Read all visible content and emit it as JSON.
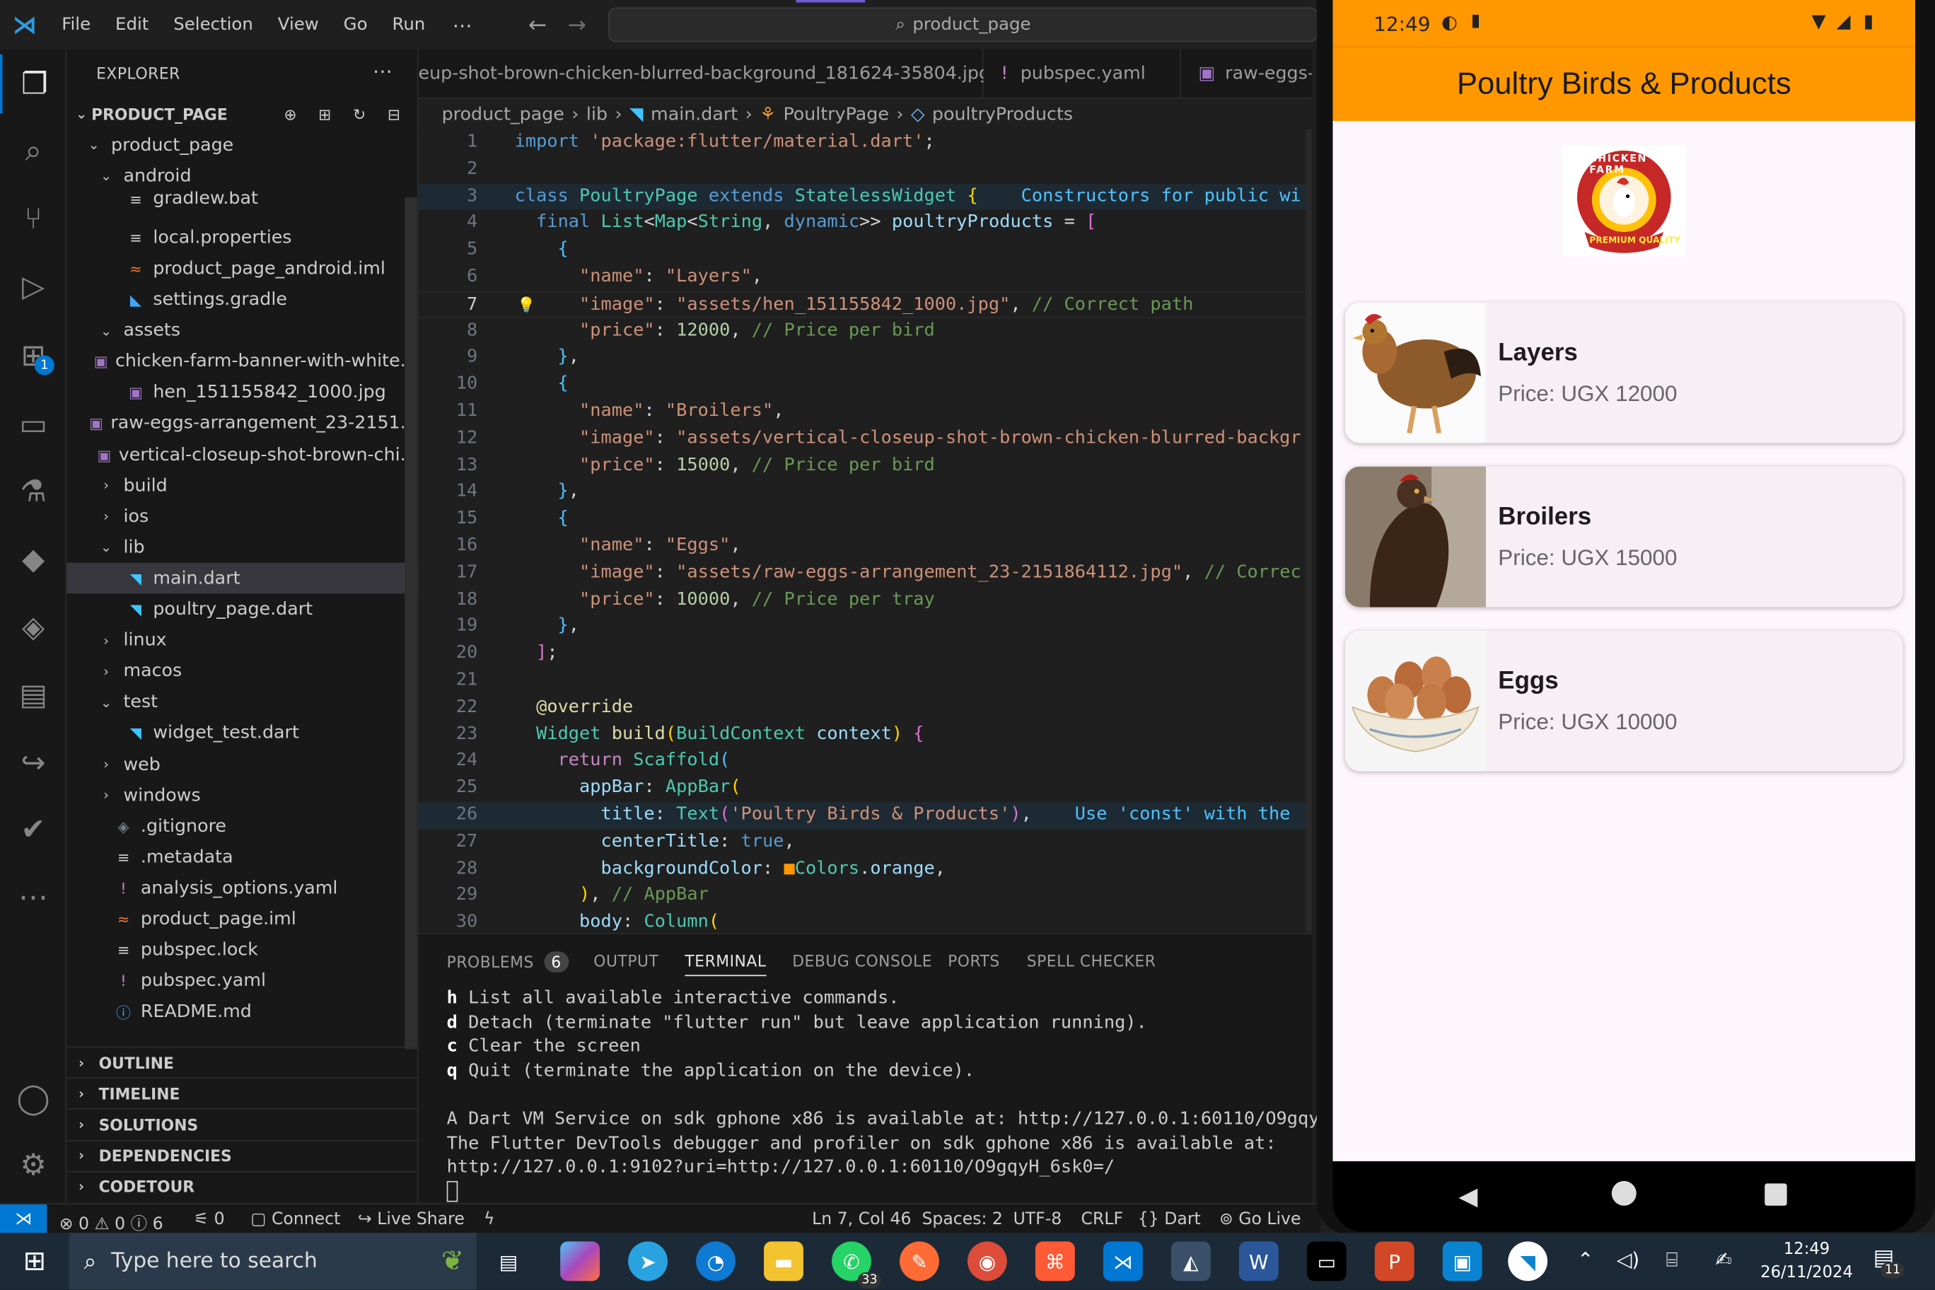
{
  "titlebar": {
    "menus": [
      "File",
      "Edit",
      "Selection",
      "View",
      "Go",
      "Run"
    ],
    "more": "⋯",
    "search_text": "product_page"
  },
  "sidebar": {
    "title": "EXPLORER",
    "project": "PRODUCT_PAGE",
    "rows": [
      {
        "label": "product_page",
        "indent": 1,
        "chev": "v"
      },
      {
        "label": "android",
        "indent": 2,
        "chev": "v"
      },
      {
        "label": "gradlew.bat",
        "indent": 3,
        "icon": "≡"
      },
      {
        "label": "local.properties",
        "indent": 3,
        "icon": "≡"
      },
      {
        "label": "product_page_android.iml",
        "indent": 3,
        "icon": "≈"
      },
      {
        "label": "settings.gradle",
        "indent": 3,
        "icon": "◣"
      },
      {
        "label": "assets",
        "indent": 2,
        "chev": "v"
      },
      {
        "label": "chicken-farm-banner-with-white...",
        "indent": 3,
        "icon": "▣"
      },
      {
        "label": "hen_151155842_1000.jpg",
        "indent": 3,
        "icon": "▣"
      },
      {
        "label": "raw-eggs-arrangement_23-2151...",
        "indent": 3,
        "icon": "▣"
      },
      {
        "label": "vertical-closeup-shot-brown-chi...",
        "indent": 3,
        "icon": "▣"
      },
      {
        "label": "build",
        "indent": 2,
        "chev": ">"
      },
      {
        "label": "ios",
        "indent": 2,
        "chev": ">"
      },
      {
        "label": "lib",
        "indent": 2,
        "chev": "v"
      },
      {
        "label": "main.dart",
        "indent": 3,
        "icon": "◥",
        "selected": true
      },
      {
        "label": "poultry_page.dart",
        "indent": 3,
        "icon": "◥"
      },
      {
        "label": "linux",
        "indent": 2,
        "chev": ">"
      },
      {
        "label": "macos",
        "indent": 2,
        "chev": ">"
      },
      {
        "label": "test",
        "indent": 2,
        "chev": "v"
      },
      {
        "label": "widget_test.dart",
        "indent": 3,
        "icon": "◥"
      },
      {
        "label": "web",
        "indent": 2,
        "chev": ">"
      },
      {
        "label": "windows",
        "indent": 2,
        "chev": ">"
      },
      {
        "label": ".gitignore",
        "indent": 2,
        "icon": "◈"
      },
      {
        "label": ".metadata",
        "indent": 2,
        "icon": "≡"
      },
      {
        "label": "analysis_options.yaml",
        "indent": 2,
        "icon": "!"
      },
      {
        "label": "product_page.iml",
        "indent": 2,
        "icon": "≈"
      },
      {
        "label": "pubspec.lock",
        "indent": 2,
        "icon": "≡"
      },
      {
        "label": "pubspec.yaml",
        "indent": 2,
        "icon": "!"
      },
      {
        "label": "README.md",
        "indent": 2,
        "icon": "ⓘ"
      }
    ],
    "sections": [
      "OUTLINE",
      "TIMELINE",
      "SOLUTIONS",
      "DEPENDENCIES",
      "CODETOUR"
    ]
  },
  "tabs": [
    {
      "label": "eup-shot-brown-chicken-blurred-background_181624-35804.jpg"
    },
    {
      "label": "pubspec.yaml"
    },
    {
      "label": "raw-eggs-"
    }
  ],
  "breadcrumb": [
    "product_page",
    "lib",
    "main.dart",
    "PoultryPage",
    "poultryProducts"
  ],
  "code": [
    {
      "n": "1",
      "segs": [
        [
          "kw",
          "import "
        ],
        [
          "str",
          "'package:flutter/material.dart'"
        ],
        [
          "plain",
          ";"
        ]
      ]
    },
    {
      "n": "2",
      "segs": []
    },
    {
      "n": "3",
      "segs": [
        [
          "kw",
          "class "
        ],
        [
          "cls",
          "PoultryPage "
        ],
        [
          "kw",
          "extends "
        ],
        [
          "cls",
          "StatelessWidget "
        ],
        [
          "gold",
          "{"
        ],
        [
          "hint",
          "    Constructors for public wi"
        ]
      ]
    },
    {
      "n": "4",
      "segs": [
        [
          "plain",
          "  "
        ],
        [
          "kw",
          "final "
        ],
        [
          "cls",
          "List"
        ],
        [
          "plain",
          "<"
        ],
        [
          "cls",
          "Map"
        ],
        [
          "plain",
          "<"
        ],
        [
          "cls",
          "String"
        ],
        [
          "plain",
          ", "
        ],
        [
          "kw",
          "dynamic"
        ],
        [
          "plain",
          ">> "
        ],
        [
          "pr",
          "poultryProducts "
        ],
        [
          "plain",
          "= "
        ],
        [
          "mag",
          "["
        ]
      ]
    },
    {
      "n": "5",
      "segs": [
        [
          "plain",
          "    "
        ],
        [
          "hint",
          "{"
        ]
      ]
    },
    {
      "n": "6",
      "segs": [
        [
          "plain",
          "      "
        ],
        [
          "str",
          "\"name\""
        ],
        [
          "plain",
          ": "
        ],
        [
          "str",
          "\"Layers\""
        ],
        [
          "plain",
          ","
        ]
      ]
    },
    {
      "n": "7",
      "segs": [
        [
          "plain",
          "      "
        ],
        [
          "str",
          "\"image\""
        ],
        [
          "plain",
          ": "
        ],
        [
          "str",
          "\"assets/hen_151155842_1000.jpg\""
        ],
        [
          "plain",
          ", "
        ],
        [
          "cm",
          "// Correct path"
        ]
      ]
    },
    {
      "n": "8",
      "segs": [
        [
          "plain",
          "      "
        ],
        [
          "str",
          "\"price\""
        ],
        [
          "plain",
          ": "
        ],
        [
          "num",
          "12000"
        ],
        [
          "plain",
          ", "
        ],
        [
          "cm",
          "// Price per bird"
        ]
      ]
    },
    {
      "n": "9",
      "segs": [
        [
          "plain",
          "    "
        ],
        [
          "hint",
          "}"
        ],
        [
          "plain",
          ","
        ]
      ]
    },
    {
      "n": "10",
      "segs": [
        [
          "plain",
          "    "
        ],
        [
          "hint",
          "{"
        ]
      ]
    },
    {
      "n": "11",
      "segs": [
        [
          "plain",
          "      "
        ],
        [
          "str",
          "\"name\""
        ],
        [
          "plain",
          ": "
        ],
        [
          "str",
          "\"Broilers\""
        ],
        [
          "plain",
          ","
        ]
      ]
    },
    {
      "n": "12",
      "segs": [
        [
          "plain",
          "      "
        ],
        [
          "str",
          "\"image\""
        ],
        [
          "plain",
          ": "
        ],
        [
          "str",
          "\"assets/vertical-closeup-shot-brown-chicken-blurred-backgr"
        ]
      ]
    },
    {
      "n": "13",
      "segs": [
        [
          "plain",
          "      "
        ],
        [
          "str",
          "\"price\""
        ],
        [
          "plain",
          ": "
        ],
        [
          "num",
          "15000"
        ],
        [
          "plain",
          ", "
        ],
        [
          "cm",
          "// Price per bird"
        ]
      ]
    },
    {
      "n": "14",
      "segs": [
        [
          "plain",
          "    "
        ],
        [
          "hint",
          "}"
        ],
        [
          "plain",
          ","
        ]
      ]
    },
    {
      "n": "15",
      "segs": [
        [
          "plain",
          "    "
        ],
        [
          "hint",
          "{"
        ]
      ]
    },
    {
      "n": "16",
      "segs": [
        [
          "plain",
          "      "
        ],
        [
          "str",
          "\"name\""
        ],
        [
          "plain",
          ": "
        ],
        [
          "str",
          "\"Eggs\""
        ],
        [
          "plain",
          ","
        ]
      ]
    },
    {
      "n": "17",
      "segs": [
        [
          "plain",
          "      "
        ],
        [
          "str",
          "\"image\""
        ],
        [
          "plain",
          ": "
        ],
        [
          "str",
          "\"assets/raw-eggs-arrangement_23-2151864112.jpg\""
        ],
        [
          "plain",
          ", "
        ],
        [
          "cm",
          "// Correc"
        ]
      ]
    },
    {
      "n": "18",
      "segs": [
        [
          "plain",
          "      "
        ],
        [
          "str",
          "\"price\""
        ],
        [
          "plain",
          ": "
        ],
        [
          "num",
          "10000"
        ],
        [
          "plain",
          ", "
        ],
        [
          "cm",
          "// Price per tray"
        ]
      ]
    },
    {
      "n": "19",
      "segs": [
        [
          "plain",
          "    "
        ],
        [
          "hint",
          "}"
        ],
        [
          "plain",
          ","
        ]
      ]
    },
    {
      "n": "20",
      "segs": [
        [
          "plain",
          "  "
        ],
        [
          "mag",
          "]"
        ],
        [
          "plain",
          ";"
        ]
      ]
    },
    {
      "n": "21",
      "segs": []
    },
    {
      "n": "22",
      "segs": [
        [
          "plain",
          "  "
        ],
        [
          "fn",
          "@override"
        ]
      ]
    },
    {
      "n": "23",
      "segs": [
        [
          "plain",
          "  "
        ],
        [
          "cls",
          "Widget "
        ],
        [
          "fn",
          "build"
        ],
        [
          "gold",
          "("
        ],
        [
          "cls",
          "BuildContext "
        ],
        [
          "pr",
          "context"
        ],
        [
          "gold",
          ") "
        ],
        [
          "mag",
          "{"
        ]
      ]
    },
    {
      "n": "24",
      "segs": [
        [
          "plain",
          "    "
        ],
        [
          "kc",
          "return "
        ],
        [
          "cls",
          "Scaffold"
        ],
        [
          "hint",
          "("
        ]
      ]
    },
    {
      "n": "25",
      "segs": [
        [
          "plain",
          "      "
        ],
        [
          "pr",
          "appBar"
        ],
        [
          "plain",
          ": "
        ],
        [
          "cls",
          "AppBar"
        ],
        [
          "gold",
          "("
        ]
      ]
    },
    {
      "n": "26",
      "segs": [
        [
          "plain",
          "        "
        ],
        [
          "pr",
          "title"
        ],
        [
          "plain",
          ": "
        ],
        [
          "cls",
          "Text"
        ],
        [
          "mag",
          "("
        ],
        [
          "str",
          "'Poultry Birds & Products'"
        ],
        [
          "mag",
          ")"
        ],
        [
          "plain",
          ",    "
        ],
        [
          "hint",
          "Use 'const' with the"
        ]
      ]
    },
    {
      "n": "27",
      "segs": [
        [
          "plain",
          "        "
        ],
        [
          "pr",
          "centerTitle"
        ],
        [
          "plain",
          ": "
        ],
        [
          "kw",
          "true"
        ],
        [
          "plain",
          ","
        ]
      ]
    },
    {
      "n": "28",
      "segs": [
        [
          "plain",
          "        "
        ],
        [
          "pr",
          "backgroundColor"
        ],
        [
          "plain",
          ": "
        ],
        [
          "cls",
          "■"
        ],
        [
          "cls",
          "Colors"
        ],
        [
          "plain",
          "."
        ],
        [
          "pr",
          "orange"
        ],
        [
          "plain",
          ","
        ]
      ]
    },
    {
      "n": "29",
      "segs": [
        [
          "plain",
          "      "
        ],
        [
          "gold",
          ")"
        ],
        [
          "plain",
          ", "
        ],
        [
          "cm",
          "// AppBar"
        ]
      ]
    },
    {
      "n": "30",
      "segs": [
        [
          "plain",
          "      "
        ],
        [
          "pr",
          "body"
        ],
        [
          "plain",
          ": "
        ],
        [
          "cls",
          "Column"
        ],
        [
          "gold",
          "("
        ]
      ]
    }
  ],
  "panel": {
    "tabs": [
      "PROBLEMS",
      "OUTPUT",
      "TERMINAL",
      "DEBUG CONSOLE",
      "PORTS",
      "SPELL CHECKER"
    ],
    "problems_count": "6",
    "terminal": [
      {
        "k": "h",
        "t": " List all available interactive commands."
      },
      {
        "k": "d",
        "t": " Detach (terminate \"flutter run\" but leave application running)."
      },
      {
        "k": "c",
        "t": " Clear the screen"
      },
      {
        "k": "q",
        "t": " Quit (terminate the application on the device)."
      },
      {
        "k": "",
        "t": ""
      },
      {
        "k": "",
        "t": "A Dart VM Service on sdk gphone x86 is available at: http://127.0.0.1:60110/O9gqyH"
      },
      {
        "k": "",
        "t": "The Flutter DevTools debugger and profiler on sdk gphone x86 is available at:"
      },
      {
        "k": "",
        "t": "http://127.0.0.1:9102?uri=http://127.0.0.1:60110/O9gqyH_6sk0=/"
      }
    ]
  },
  "status": {
    "errors": "0",
    "warnings": "0",
    "infos": "6",
    "ports": "0",
    "connect": "Connect",
    "liveshare": "Live Share",
    "position": "Ln 7, Col 46",
    "spaces": "Spaces: 2",
    "encoding": "UTF-8",
    "eol": "CRLF",
    "language": "Dart",
    "golive": "Go Live"
  },
  "phone": {
    "time": "12:49",
    "appbar_title": "Poultry Birds & Products",
    "logo_text_top": "CHICKEN FARM",
    "logo_text_bottom": "PREMIUM QUALITY",
    "products": [
      {
        "name": "Layers",
        "price": "Price: UGX 12000"
      },
      {
        "name": "Broilers",
        "price": "Price: UGX 15000"
      },
      {
        "name": "Eggs",
        "price": "Price: UGX 10000"
      }
    ]
  },
  "taskbar": {
    "search_placeholder": "Type here to search",
    "whatsapp_badge": "33",
    "notif_badge": "11",
    "clock_time": "12:49",
    "clock_date": "26/11/2024"
  },
  "colors": {
    "accent": "#0078d4",
    "appbar": "#ff9800"
  }
}
